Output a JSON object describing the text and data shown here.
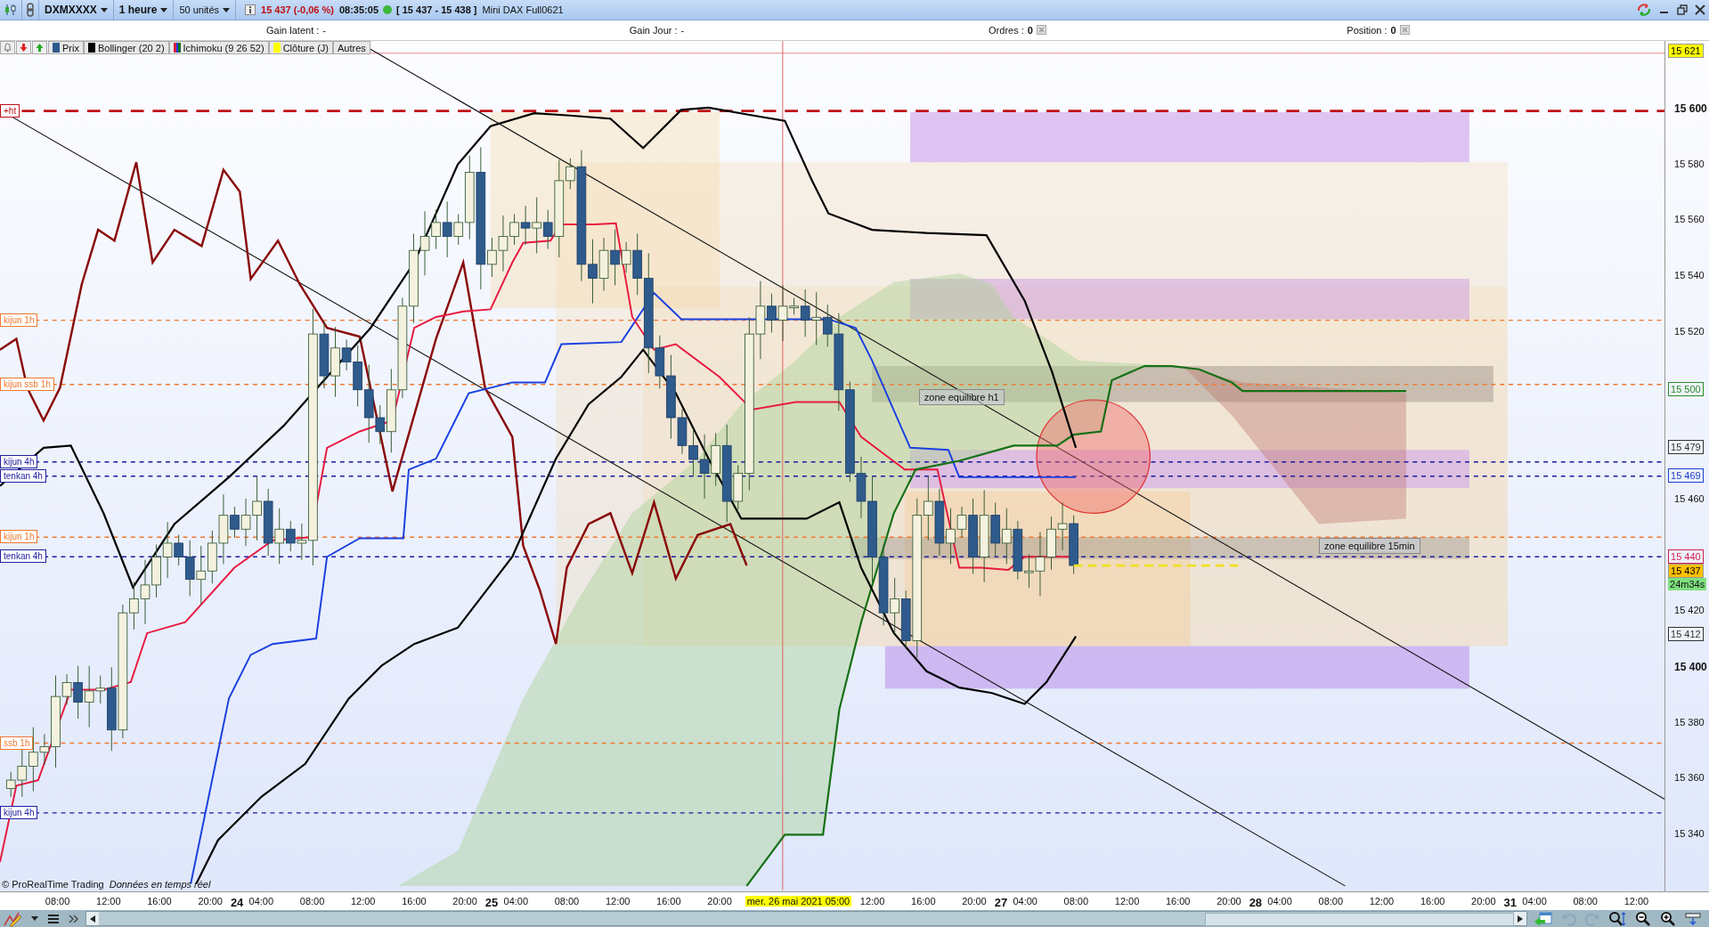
{
  "toolbar": {
    "symbol": "DXMXXXX",
    "timeframe": "1 heure",
    "units": "50 unités",
    "quote": "15 437 (-0,06 %)",
    "time": "08:35:05",
    "bid_ask": "[ 15 437 - 15 438 ]",
    "instrument": "Mini DAX Full0621"
  },
  "summary": [
    {
      "label": "Gain latent :",
      "value": "-",
      "kind": "text"
    },
    {
      "label": "Gain Jour :",
      "value": "-",
      "kind": "text"
    },
    {
      "label": "Ordres :",
      "value": "0",
      "kind": "count"
    },
    {
      "label": "Position :",
      "value": "0",
      "kind": "count"
    }
  ],
  "legend": [
    {
      "label": "Prix",
      "kind": "swatch",
      "color": "#2c5a8c"
    },
    {
      "label": "Bollinger (20 2)",
      "kind": "swatch",
      "color": "#000000"
    },
    {
      "label": "Ichimoku (9 26 52)",
      "kind": "multi"
    },
    {
      "label": "Clôture (J)",
      "kind": "swatch",
      "color": "#ffff00"
    },
    {
      "label": "Autres",
      "kind": "plain"
    }
  ],
  "levels": [
    {
      "label": "+ht",
      "kind": "target"
    },
    {
      "label": "kijun 1h",
      "kind": "hourly"
    },
    {
      "label": "kijun ssb 1h",
      "kind": "hourly"
    },
    {
      "label": "kijun 4h",
      "kind": "fourhour"
    },
    {
      "label": "tenkan 4h",
      "kind": "fourhour"
    },
    {
      "label": "kijun 1h",
      "kind": "hourly"
    },
    {
      "label": "tenkan 4h",
      "kind": "fourhour"
    },
    {
      "label": "ssb 1h",
      "kind": "hourly"
    },
    {
      "label": "kijun 4h",
      "kind": "fourhour"
    }
  ],
  "zones": [
    {
      "label": "zone equilibre h1"
    },
    {
      "label": "zone equilibre 15min"
    }
  ],
  "price_axis": {
    "ticks": [
      {
        "label": "15 600",
        "major": true
      },
      {
        "label": "15 580",
        "major": false
      },
      {
        "label": "15 560",
        "major": false
      },
      {
        "label": "15 540",
        "major": false
      },
      {
        "label": "15 520",
        "major": false
      },
      {
        "label": "15 460",
        "major": false
      },
      {
        "label": "15 420",
        "major": false
      },
      {
        "label": "15 400",
        "major": true
      },
      {
        "label": "15 380",
        "major": false
      },
      {
        "label": "15 360",
        "major": false
      },
      {
        "label": "15 340",
        "major": false
      }
    ],
    "markers": [
      {
        "label": "15 621",
        "kind": "filled",
        "color": "#ffff00"
      },
      {
        "label": "15 500",
        "kind": "boxed",
        "color": "#2a8a2a"
      },
      {
        "label": "15 479",
        "kind": "boxed",
        "color": "#333333"
      },
      {
        "label": "15 469",
        "kind": "boxed",
        "color": "#1a3fd0"
      },
      {
        "label": "15 440",
        "kind": "boxed",
        "color": "#d02050"
      },
      {
        "label": "15 437",
        "kind": "filled",
        "color": "#ffc000",
        "timer": "24m34s"
      },
      {
        "label": "15 412",
        "kind": "boxed",
        "color": "#333333"
      }
    ]
  },
  "time_axis": [
    {
      "time": "08:00"
    },
    {
      "time": "12:00"
    },
    {
      "time": "16:00"
    },
    {
      "time": "20:00"
    },
    {
      "day": "24",
      "time": "04:00"
    },
    {
      "time": "08:00"
    },
    {
      "time": "12:00"
    },
    {
      "time": "16:00"
    },
    {
      "time": "20:00"
    },
    {
      "day": "25",
      "time": "04:00"
    },
    {
      "time": "08:00"
    },
    {
      "time": "12:00"
    },
    {
      "time": "16:00"
    },
    {
      "time": "20:00"
    },
    {
      "kind": "cursor",
      "time": "mer. 26 mai 2021 05:00"
    },
    {
      "time": "12:00"
    },
    {
      "time": "16:00"
    },
    {
      "time": "20:00"
    },
    {
      "day": "27",
      "time": "04:00"
    },
    {
      "time": "08:00"
    },
    {
      "time": "12:00"
    },
    {
      "time": "16:00"
    },
    {
      "time": "20:00"
    },
    {
      "day": "28",
      "time": "04:00"
    },
    {
      "time": "08:00"
    },
    {
      "time": "12:00"
    },
    {
      "time": "16:00"
    },
    {
      "time": "20:00"
    },
    {
      "day": "31",
      "time": "04:00"
    },
    {
      "time": "08:00"
    },
    {
      "time": "12:00"
    }
  ],
  "credits": {
    "brand": "© ProRealTime Trading",
    "status": "Données en temps réel"
  }
}
